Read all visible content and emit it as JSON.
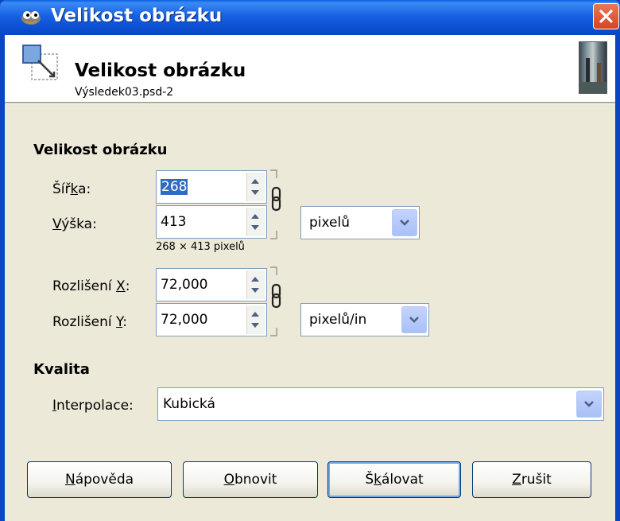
{
  "window": {
    "title": "Velikost obrázku"
  },
  "header": {
    "title": "Velikost obrázku",
    "subtitle": "Výsledek03.psd-2"
  },
  "size_section": {
    "label": "Velikost obrázku",
    "width_label_pre": "Šíř",
    "width_label_mnemonic": "k",
    "width_label_post": "a:",
    "width_value": "268",
    "height_label_mnemonic": "V",
    "height_label_post": "ýška:",
    "height_value": "413",
    "dims_text": "268 × 413 pixelů",
    "unit": "pixelů",
    "res_x_label_pre": "Rozlišení ",
    "res_x_label_mnemonic": "X",
    "res_x_label_post": ":",
    "res_x_value": "72,000",
    "res_y_label_pre": "Rozlišení ",
    "res_y_label_mnemonic": "Y",
    "res_y_label_post": ":",
    "res_y_value": "72,000",
    "res_unit": "pixelů/in"
  },
  "quality_section": {
    "label": "Kvalita",
    "interp_label_mnemonic": "I",
    "interp_label_post": "nterpolace:",
    "interp_value": "Kubická"
  },
  "buttons": {
    "help_mnemonic": "N",
    "help_post": "ápověda",
    "reset_mnemonic": "O",
    "reset_post": "bnovit",
    "scale_pre": "Š",
    "scale_mnemonic": "k",
    "scale_post": "álovat",
    "cancel_mnemonic": "Z",
    "cancel_post": "rušit"
  },
  "icons": {
    "title": "gimp-wilber-icon",
    "close": "close-icon",
    "header": "scale-image-icon",
    "chain": "chain-link-icon",
    "spin": "spin-arrows-icon",
    "dropdown": "chevron-down-icon"
  },
  "colors": {
    "titlebar": "#0a5fe0",
    "dialog_bg": "#ece9d8",
    "selection": "#316ac5",
    "close_button": "#d5451f"
  }
}
